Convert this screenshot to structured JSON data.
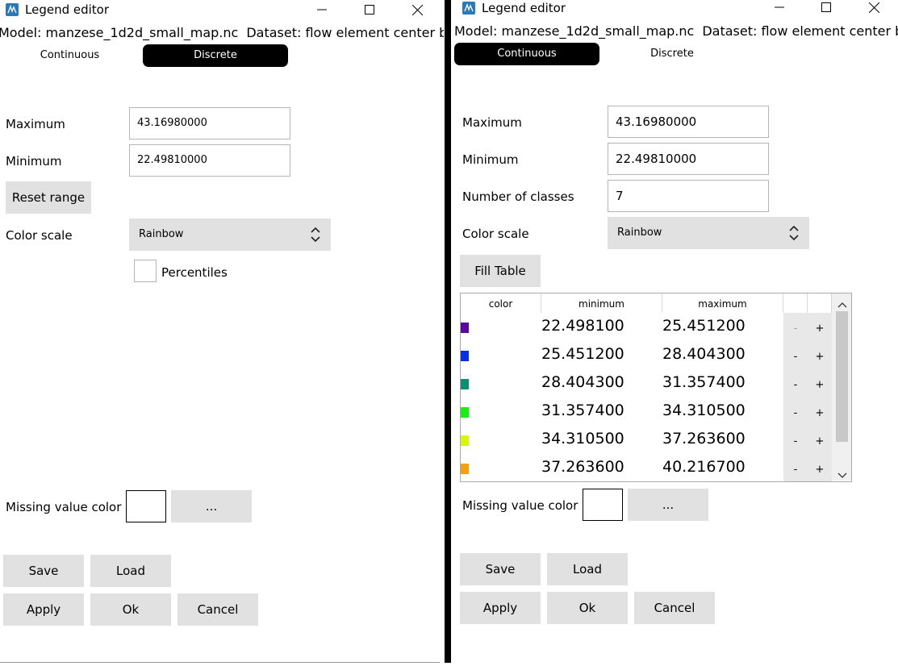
{
  "left": {
    "window_title": "Legend editor",
    "header": {
      "model": "Model: manzese_1d2d_small_map.nc",
      "dataset": "Dataset: flow element center bed"
    },
    "tabs": {
      "continuous": "Continuous",
      "discrete": "Discrete",
      "active": "discrete"
    },
    "maximum_label": "Maximum",
    "maximum_value": "43.16980000",
    "minimum_label": "Minimum",
    "minimum_value": "22.49810000",
    "reset_range": "Reset range",
    "color_scale_label": "Color scale",
    "color_scale_value": "Rainbow",
    "percentiles_label": "Percentiles",
    "missing_label": "Missing value color",
    "missing_more": "...",
    "save": "Save",
    "load": "Load",
    "apply": "Apply",
    "ok": "Ok",
    "cancel": "Cancel"
  },
  "right": {
    "window_title": "Legend editor",
    "header": {
      "model": "Model: manzese_1d2d_small_map.nc",
      "dataset": "Dataset: flow element center bed"
    },
    "tabs": {
      "continuous": "Continuous",
      "discrete": "Discrete",
      "active": "continuous"
    },
    "maximum_label": "Maximum",
    "maximum_value": "43.16980000",
    "minimum_label": "Minimum",
    "minimum_value": "22.49810000",
    "classes_label": "Number of classes",
    "classes_value": "7",
    "color_scale_label": "Color scale",
    "color_scale_value": "Rainbow",
    "fill_table": "Fill Table",
    "table": {
      "headers": {
        "color": "color",
        "minimum": "minimum",
        "maximum": "maximum"
      },
      "rows": [
        {
          "color": "#5b0a9e",
          "min": "22.498100",
          "max": "25.451200",
          "minus": "-",
          "plus": "+"
        },
        {
          "color": "#0a2ee6",
          "min": "25.451200",
          "max": "28.404300",
          "minus": "-",
          "plus": "+"
        },
        {
          "color": "#0e9070",
          "min": "28.404300",
          "max": "31.357400",
          "minus": "-",
          "plus": "+"
        },
        {
          "color": "#1aee12",
          "min": "31.357400",
          "max": "34.310500",
          "minus": "-",
          "plus": "+"
        },
        {
          "color": "#d8f510",
          "min": "34.310500",
          "max": "37.263600",
          "minus": "-",
          "plus": "+"
        },
        {
          "color": "#f5a010",
          "min": "37.263600",
          "max": "40.216700",
          "minus": "-",
          "plus": "+"
        }
      ]
    },
    "missing_label": "Missing value color",
    "missing_more": "...",
    "save": "Save",
    "load": "Load",
    "apply": "Apply",
    "ok": "Ok",
    "cancel": "Cancel"
  }
}
